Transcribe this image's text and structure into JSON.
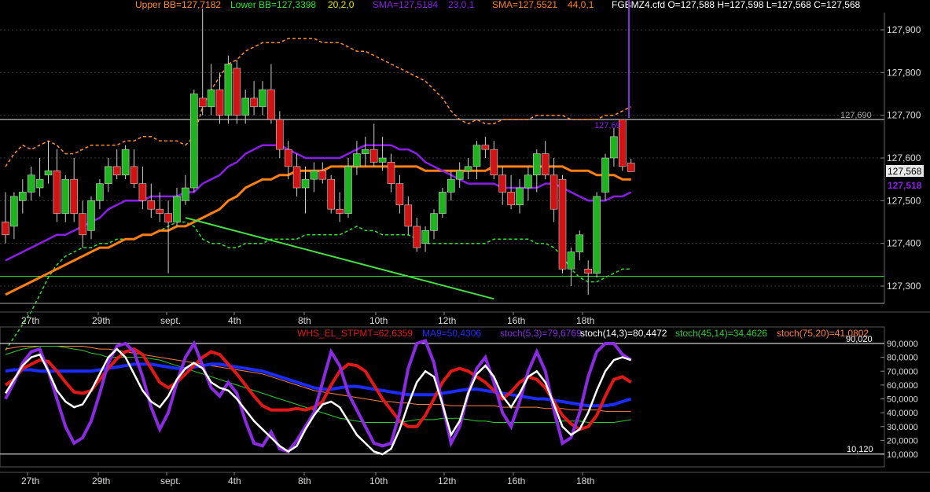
{
  "header": {
    "upper_bb": "Upper BB=127,7182",
    "lower_bb": "Lower BB=127,3398",
    "bb_params": "20,2,0",
    "sma1": "SMA=127,5184",
    "sma1_params": "23,0,1",
    "sma2": "SMA=127,5521",
    "sma2_params": "44,0,1",
    "quote": "FGBMZ4.cfd O=127,588 H=127,598 L=127,568 C=127,568"
  },
  "colors": {
    "bg": "#000000",
    "up": "#1fb31f",
    "down": "#d01414",
    "bb": "#ff8c30",
    "sma_fast": "#8a1ee8",
    "sma_slow": "#ff7f10",
    "lower_bb": "#2ee02e",
    "trend": "#44e044",
    "whs": "#e01818",
    "ma9": "#1a2cff",
    "stoch53": "#8a2be2",
    "stoch14": "#ffffff",
    "stoch45": "#2ecc2e",
    "stoch75": "#ff8040"
  },
  "x_labels": [
    "27th",
    "29th",
    "sept.",
    "4th",
    "8th",
    "10th",
    "12th",
    "16th",
    "18th"
  ],
  "price_panel": {
    "ticks": [
      "127,900",
      "127,800",
      "127,700",
      "127,600",
      "127,500",
      "127,400",
      "127,300"
    ],
    "hline_label": "127,690",
    "last_price": "127,568",
    "sma_value": "127,518",
    "bb_mark": "127,69"
  },
  "osc_panel": {
    "legend": {
      "whs": "WHS_EL_STPMT=62,6359",
      "ma9": "MA9=50,4306",
      "stoch53": "stoch(5,3)=79,6769",
      "stoch14": "stoch(14,3)=80,4472",
      "stoch45": "stoch(45,14)=34,4626",
      "stoch75": "stoch(75,20)=41,0802"
    },
    "upper_level": "90,020",
    "lower_level": "10,120",
    "ticks": [
      "90,0000",
      "80,0000",
      "70,0000",
      "60,0000",
      "50,0000",
      "40,0000",
      "30,0000",
      "20,0000",
      "10,0000"
    ]
  },
  "chart_data": {
    "type": "line",
    "title": "FGBMZ4.cfd",
    "candles": [
      {
        "o": 127.45,
        "h": 127.52,
        "l": 127.4,
        "c": 127.42
      },
      {
        "o": 127.44,
        "h": 127.52,
        "l": 127.41,
        "c": 127.51
      },
      {
        "o": 127.5,
        "h": 127.55,
        "l": 127.47,
        "c": 127.52
      },
      {
        "o": 127.52,
        "h": 127.58,
        "l": 127.5,
        "c": 127.56
      },
      {
        "o": 127.53,
        "h": 127.6,
        "l": 127.51,
        "c": 127.55
      },
      {
        "o": 127.56,
        "h": 127.64,
        "l": 127.54,
        "c": 127.57
      },
      {
        "o": 127.57,
        "h": 127.62,
        "l": 127.45,
        "c": 127.47
      },
      {
        "o": 127.47,
        "h": 127.56,
        "l": 127.45,
        "c": 127.55
      },
      {
        "o": 127.55,
        "h": 127.6,
        "l": 127.45,
        "c": 127.47
      },
      {
        "o": 127.47,
        "h": 127.5,
        "l": 127.39,
        "c": 127.42
      },
      {
        "o": 127.43,
        "h": 127.51,
        "l": 127.41,
        "c": 127.5
      },
      {
        "o": 127.5,
        "h": 127.55,
        "l": 127.48,
        "c": 127.54
      },
      {
        "o": 127.54,
        "h": 127.6,
        "l": 127.52,
        "c": 127.58
      },
      {
        "o": 127.58,
        "h": 127.62,
        "l": 127.55,
        "c": 127.56
      },
      {
        "o": 127.56,
        "h": 127.63,
        "l": 127.55,
        "c": 127.62
      },
      {
        "o": 127.58,
        "h": 127.62,
        "l": 127.53,
        "c": 127.54
      },
      {
        "o": 127.54,
        "h": 127.58,
        "l": 127.48,
        "c": 127.5
      },
      {
        "o": 127.5,
        "h": 127.54,
        "l": 127.46,
        "c": 127.48
      },
      {
        "o": 127.48,
        "h": 127.52,
        "l": 127.45,
        "c": 127.47
      },
      {
        "o": 127.47,
        "h": 127.5,
        "l": 127.33,
        "c": 127.45
      },
      {
        "o": 127.45,
        "h": 127.53,
        "l": 127.44,
        "c": 127.51
      },
      {
        "o": 127.5,
        "h": 127.56,
        "l": 127.49,
        "c": 127.53
      },
      {
        "o": 127.53,
        "h": 127.76,
        "l": 127.52,
        "c": 127.75
      },
      {
        "o": 127.74,
        "h": 127.95,
        "l": 127.7,
        "c": 127.72
      },
      {
        "o": 127.72,
        "h": 127.82,
        "l": 127.7,
        "c": 127.76
      },
      {
        "o": 127.76,
        "h": 127.8,
        "l": 127.68,
        "c": 127.7
      },
      {
        "o": 127.7,
        "h": 127.84,
        "l": 127.68,
        "c": 127.82
      },
      {
        "o": 127.81,
        "h": 127.83,
        "l": 127.68,
        "c": 127.7
      },
      {
        "o": 127.7,
        "h": 127.76,
        "l": 127.68,
        "c": 127.74
      },
      {
        "o": 127.74,
        "h": 127.78,
        "l": 127.7,
        "c": 127.72
      },
      {
        "o": 127.72,
        "h": 127.78,
        "l": 127.7,
        "c": 127.76
      },
      {
        "o": 127.76,
        "h": 127.82,
        "l": 127.68,
        "c": 127.69
      },
      {
        "o": 127.69,
        "h": 127.71,
        "l": 127.6,
        "c": 127.62
      },
      {
        "o": 127.62,
        "h": 127.64,
        "l": 127.55,
        "c": 127.58
      },
      {
        "o": 127.58,
        "h": 127.61,
        "l": 127.51,
        "c": 127.53
      },
      {
        "o": 127.53,
        "h": 127.58,
        "l": 127.47,
        "c": 127.55
      },
      {
        "o": 127.55,
        "h": 127.59,
        "l": 127.52,
        "c": 127.57
      },
      {
        "o": 127.57,
        "h": 127.59,
        "l": 127.54,
        "c": 127.55
      },
      {
        "o": 127.55,
        "h": 127.56,
        "l": 127.47,
        "c": 127.48
      },
      {
        "o": 127.48,
        "h": 127.52,
        "l": 127.45,
        "c": 127.47
      },
      {
        "o": 127.47,
        "h": 127.6,
        "l": 127.46,
        "c": 127.58
      },
      {
        "o": 127.58,
        "h": 127.64,
        "l": 127.56,
        "c": 127.61
      },
      {
        "o": 127.61,
        "h": 127.65,
        "l": 127.58,
        "c": 127.62
      },
      {
        "o": 127.62,
        "h": 127.68,
        "l": 127.58,
        "c": 127.59
      },
      {
        "o": 127.59,
        "h": 127.65,
        "l": 127.57,
        "c": 127.6
      },
      {
        "o": 127.59,
        "h": 127.61,
        "l": 127.52,
        "c": 127.54
      },
      {
        "o": 127.54,
        "h": 127.56,
        "l": 127.47,
        "c": 127.49
      },
      {
        "o": 127.49,
        "h": 127.51,
        "l": 127.42,
        "c": 127.44
      },
      {
        "o": 127.44,
        "h": 127.46,
        "l": 127.38,
        "c": 127.39
      },
      {
        "o": 127.4,
        "h": 127.44,
        "l": 127.38,
        "c": 127.43
      },
      {
        "o": 127.43,
        "h": 127.48,
        "l": 127.41,
        "c": 127.47
      },
      {
        "o": 127.47,
        "h": 127.53,
        "l": 127.46,
        "c": 127.52
      },
      {
        "o": 127.52,
        "h": 127.57,
        "l": 127.5,
        "c": 127.55
      },
      {
        "o": 127.55,
        "h": 127.59,
        "l": 127.53,
        "c": 127.57
      },
      {
        "o": 127.57,
        "h": 127.6,
        "l": 127.55,
        "c": 127.58
      },
      {
        "o": 127.58,
        "h": 127.64,
        "l": 127.55,
        "c": 127.63
      },
      {
        "o": 127.63,
        "h": 127.65,
        "l": 127.6,
        "c": 127.62
      },
      {
        "o": 127.62,
        "h": 127.64,
        "l": 127.55,
        "c": 127.56
      },
      {
        "o": 127.56,
        "h": 127.58,
        "l": 127.49,
        "c": 127.52
      },
      {
        "o": 127.52,
        "h": 127.56,
        "l": 127.48,
        "c": 127.49
      },
      {
        "o": 127.49,
        "h": 127.55,
        "l": 127.47,
        "c": 127.53
      },
      {
        "o": 127.53,
        "h": 127.58,
        "l": 127.5,
        "c": 127.56
      },
      {
        "o": 127.56,
        "h": 127.62,
        "l": 127.52,
        "c": 127.61
      },
      {
        "o": 127.61,
        "h": 127.64,
        "l": 127.55,
        "c": 127.56
      },
      {
        "o": 127.56,
        "h": 127.6,
        "l": 127.45,
        "c": 127.48
      },
      {
        "o": 127.55,
        "h": 127.56,
        "l": 127.33,
        "c": 127.34
      },
      {
        "o": 127.34,
        "h": 127.39,
        "l": 127.3,
        "c": 127.38
      },
      {
        "o": 127.38,
        "h": 127.43,
        "l": 127.36,
        "c": 127.42
      },
      {
        "o": 127.34,
        "h": 127.36,
        "l": 127.28,
        "c": 127.33
      },
      {
        "o": 127.33,
        "h": 127.52,
        "l": 127.32,
        "c": 127.51
      },
      {
        "o": 127.52,
        "h": 127.61,
        "l": 127.5,
        "c": 127.6
      },
      {
        "o": 127.6,
        "h": 127.67,
        "l": 127.58,
        "c": 127.65
      },
      {
        "o": 127.69,
        "h": 127.69,
        "l": 127.57,
        "c": 127.58
      },
      {
        "o": 127.588,
        "h": 127.598,
        "l": 127.568,
        "c": 127.568
      }
    ],
    "price_ylim": [
      127.25,
      127.94
    ],
    "osc_ylim": [
      4,
      96
    ],
    "upper_bb": [
      127.58,
      127.61,
      127.63,
      127.62,
      127.63,
      127.64,
      127.63,
      127.61,
      127.61,
      127.62,
      127.63,
      127.63,
      127.63,
      127.63,
      127.64,
      127.64,
      127.65,
      127.65,
      127.64,
      127.64,
      127.64,
      127.63,
      127.65,
      127.72,
      127.76,
      127.79,
      127.82,
      127.83,
      127.85,
      127.86,
      127.87,
      127.87,
      127.87,
      127.88,
      127.88,
      127.88,
      127.88,
      127.87,
      127.87,
      127.87,
      127.86,
      127.85,
      127.85,
      127.84,
      127.83,
      127.82,
      127.81,
      127.8,
      127.79,
      127.78,
      127.76,
      127.74,
      127.71,
      127.69,
      127.68,
      127.69,
      127.68,
      127.68,
      127.69,
      127.69,
      127.69,
      127.69,
      127.7,
      127.7,
      127.7,
      127.7,
      127.69,
      127.69,
      127.69,
      127.69,
      127.7,
      127.7,
      127.71,
      127.72
    ],
    "lower_bb": [
      127.15,
      127.18,
      127.21,
      127.24,
      127.28,
      127.32,
      127.35,
      127.37,
      127.38,
      127.39,
      127.39,
      127.4,
      127.4,
      127.41,
      127.41,
      127.41,
      127.42,
      127.42,
      127.43,
      127.44,
      127.45,
      127.45,
      127.44,
      127.41,
      127.4,
      127.4,
      127.39,
      127.39,
      127.4,
      127.4,
      127.4,
      127.41,
      127.41,
      127.41,
      127.41,
      127.42,
      127.42,
      127.42,
      127.42,
      127.42,
      127.43,
      127.44,
      127.43,
      127.43,
      127.42,
      127.42,
      127.42,
      127.42,
      127.41,
      127.4,
      127.4,
      127.4,
      127.4,
      127.4,
      127.4,
      127.4,
      127.4,
      127.41,
      127.41,
      127.41,
      127.41,
      127.41,
      127.4,
      127.4,
      127.39,
      127.37,
      127.34,
      127.32,
      127.31,
      127.31,
      127.32,
      127.33,
      127.34,
      127.34
    ],
    "sma_fast": [
      127.36,
      127.37,
      127.38,
      127.39,
      127.4,
      127.41,
      127.42,
      127.42,
      127.43,
      127.44,
      127.45,
      127.46,
      127.48,
      127.49,
      127.5,
      127.5,
      127.5,
      127.51,
      127.51,
      127.51,
      127.51,
      127.52,
      127.52,
      127.54,
      127.55,
      127.56,
      127.58,
      127.59,
      127.61,
      127.62,
      127.63,
      127.63,
      127.63,
      127.62,
      127.61,
      127.6,
      127.6,
      127.6,
      127.6,
      127.6,
      127.61,
      127.62,
      127.63,
      127.63,
      127.63,
      127.63,
      127.62,
      127.62,
      127.61,
      127.59,
      127.58,
      127.57,
      127.56,
      127.55,
      127.54,
      127.54,
      127.54,
      127.54,
      127.53,
      127.53,
      127.53,
      127.53,
      127.53,
      127.54,
      127.54,
      127.53,
      127.52,
      127.51,
      127.5,
      127.5,
      127.5,
      127.51,
      127.51,
      127.52
    ],
    "sma_slow": [
      127.28,
      127.29,
      127.3,
      127.31,
      127.32,
      127.33,
      127.34,
      127.35,
      127.36,
      127.37,
      127.38,
      127.39,
      127.39,
      127.4,
      127.41,
      127.41,
      127.42,
      127.42,
      127.43,
      127.43,
      127.44,
      127.44,
      127.45,
      127.46,
      127.47,
      127.48,
      127.5,
      127.51,
      127.53,
      127.54,
      127.55,
      127.55,
      127.56,
      127.56,
      127.57,
      127.57,
      127.57,
      127.57,
      127.58,
      127.58,
      127.58,
      127.58,
      127.58,
      127.58,
      127.58,
      127.58,
      127.58,
      127.58,
      127.58,
      127.57,
      127.57,
      127.57,
      127.57,
      127.57,
      127.57,
      127.57,
      127.57,
      127.58,
      127.58,
      127.58,
      127.58,
      127.58,
      127.58,
      127.58,
      127.58,
      127.58,
      127.57,
      127.57,
      127.57,
      127.56,
      127.56,
      127.56,
      127.55,
      127.55
    ],
    "trend_line": [
      {
        "x": 21,
        "y": 127.46
      },
      {
        "x": 57,
        "y": 127.27
      }
    ],
    "support_level": 127.323,
    "resistance_level": 127.69,
    "whs": [
      60,
      64,
      72,
      75,
      78,
      77,
      70,
      62,
      55,
      54,
      56,
      64,
      72,
      79,
      84,
      86,
      82,
      72,
      62,
      58,
      62,
      68,
      74,
      80,
      84,
      82,
      75,
      68,
      60,
      52,
      45,
      42,
      42,
      42,
      43,
      42,
      44,
      48,
      60,
      70,
      75,
      74,
      70,
      60,
      50,
      42,
      34,
      30,
      30,
      38,
      50,
      62,
      70,
      72,
      70,
      66,
      62,
      56,
      50,
      55,
      62,
      66,
      64,
      58,
      48,
      38,
      32,
      28,
      30,
      38,
      52,
      64,
      66,
      62
    ],
    "ma9": [
      70,
      71,
      71,
      71,
      70,
      70,
      70,
      70,
      70,
      70,
      70,
      71,
      72,
      73,
      74,
      75,
      75,
      75,
      74,
      73,
      72,
      72,
      73,
      74,
      75,
      75,
      74,
      73,
      72,
      71,
      70,
      68,
      66,
      64,
      62,
      60,
      58,
      57,
      57,
      58,
      59,
      59,
      58,
      57,
      56,
      55,
      54,
      53,
      53,
      53,
      53,
      54,
      55,
      56,
      57,
      57,
      56,
      55,
      54,
      53,
      52,
      51,
      50,
      50,
      49,
      48,
      47,
      46,
      45,
      45,
      45,
      46,
      48,
      50
    ],
    "stoch53": [
      50,
      62,
      76,
      84,
      86,
      70,
      50,
      30,
      18,
      22,
      34,
      54,
      76,
      88,
      90,
      84,
      66,
      44,
      28,
      40,
      62,
      80,
      90,
      74,
      58,
      52,
      62,
      54,
      34,
      18,
      16,
      26,
      14,
      12,
      20,
      30,
      40,
      62,
      84,
      74,
      54,
      42,
      30,
      18,
      16,
      18,
      40,
      72,
      90,
      92,
      76,
      46,
      18,
      30,
      54,
      72,
      80,
      62,
      40,
      30,
      48,
      70,
      84,
      70,
      42,
      18,
      22,
      40,
      66,
      84,
      90,
      90,
      82,
      78
    ],
    "stoch14": [
      54,
      64,
      74,
      80,
      82,
      70,
      56,
      48,
      44,
      46,
      56,
      68,
      80,
      86,
      80,
      68,
      56,
      48,
      44,
      52,
      64,
      72,
      76,
      72,
      62,
      58,
      56,
      50,
      42,
      34,
      28,
      22,
      16,
      12,
      16,
      28,
      38,
      46,
      48,
      44,
      34,
      24,
      18,
      12,
      10,
      14,
      28,
      46,
      62,
      70,
      66,
      46,
      24,
      34,
      54,
      68,
      74,
      66,
      52,
      44,
      54,
      66,
      70,
      62,
      46,
      30,
      24,
      28,
      40,
      56,
      70,
      78,
      80,
      78
    ],
    "stoch45": [
      82,
      84,
      86,
      87,
      88,
      88,
      88,
      87,
      86,
      85,
      83,
      82,
      80,
      80,
      80,
      80,
      80,
      79,
      78,
      76,
      74,
      72,
      70,
      68,
      66,
      64,
      62,
      60,
      58,
      56,
      54,
      52,
      50,
      48,
      46,
      44,
      42,
      40,
      38,
      36,
      35,
      34,
      33,
      33,
      33,
      33,
      33,
      34,
      35,
      35,
      35,
      36,
      36,
      36,
      35,
      34,
      34,
      33,
      33,
      33,
      33,
      33,
      33,
      33,
      33,
      34,
      34,
      34,
      33,
      33,
      33,
      33,
      34,
      35
    ],
    "stoch75": [
      86,
      87,
      88,
      88,
      88,
      88,
      88,
      88,
      88,
      88,
      87,
      86,
      86,
      85,
      84,
      83,
      82,
      81,
      80,
      79,
      78,
      77,
      76,
      75,
      74,
      73,
      72,
      71,
      70,
      69,
      68,
      66,
      64,
      62,
      60,
      58,
      56,
      55,
      54,
      53,
      52,
      51,
      50,
      49,
      48,
      48,
      47,
      47,
      46,
      46,
      46,
      46,
      45,
      45,
      45,
      45,
      45,
      45,
      44,
      44,
      44,
      44,
      44,
      43,
      43,
      43,
      42,
      42,
      42,
      42,
      41,
      41,
      41,
      41
    ]
  }
}
